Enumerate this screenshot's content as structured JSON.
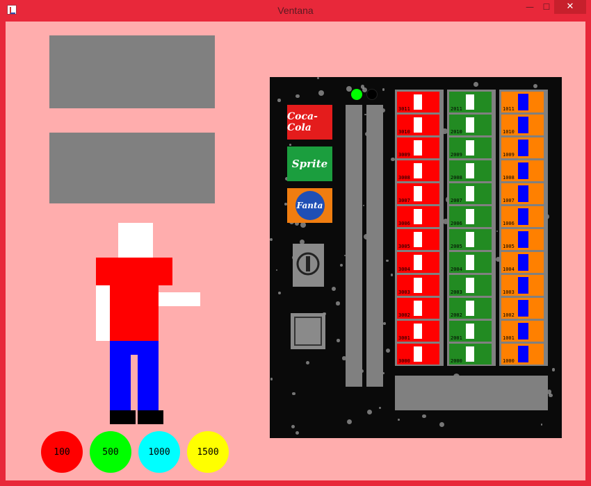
{
  "window": {
    "title": "Ventana",
    "minimize_glyph": "—",
    "maximize_glyph": "☐",
    "close_glyph": "✕"
  },
  "coins": [
    {
      "label": "100",
      "color": "#ff0000"
    },
    {
      "label": "500",
      "color": "#00ff00"
    },
    {
      "label": "1000",
      "color": "#00ffff"
    },
    {
      "label": "1500",
      "color": "#ffff00"
    }
  ],
  "brands": {
    "coke": "Coca-Cola",
    "sprite": "Sprite",
    "fanta": "Fanta"
  },
  "columns": [
    {
      "brand": "coke",
      "color": "#ff0000",
      "codes": [
        "3011",
        "3010",
        "3009",
        "3008",
        "3007",
        "3006",
        "3005",
        "3004",
        "3003",
        "3002",
        "3001",
        "3000"
      ]
    },
    {
      "brand": "sprite",
      "color": "#228b22",
      "codes": [
        "2011",
        "2010",
        "2009",
        "2008",
        "2007",
        "2006",
        "2005",
        "2004",
        "2003",
        "2002",
        "2001",
        "2000"
      ]
    },
    {
      "brand": "fanta",
      "color": "#ff8000",
      "codes": [
        "1011",
        "1010",
        "1009",
        "1008",
        "1007",
        "1006",
        "1005",
        "1004",
        "1003",
        "1002",
        "1001",
        "1000"
      ]
    }
  ]
}
